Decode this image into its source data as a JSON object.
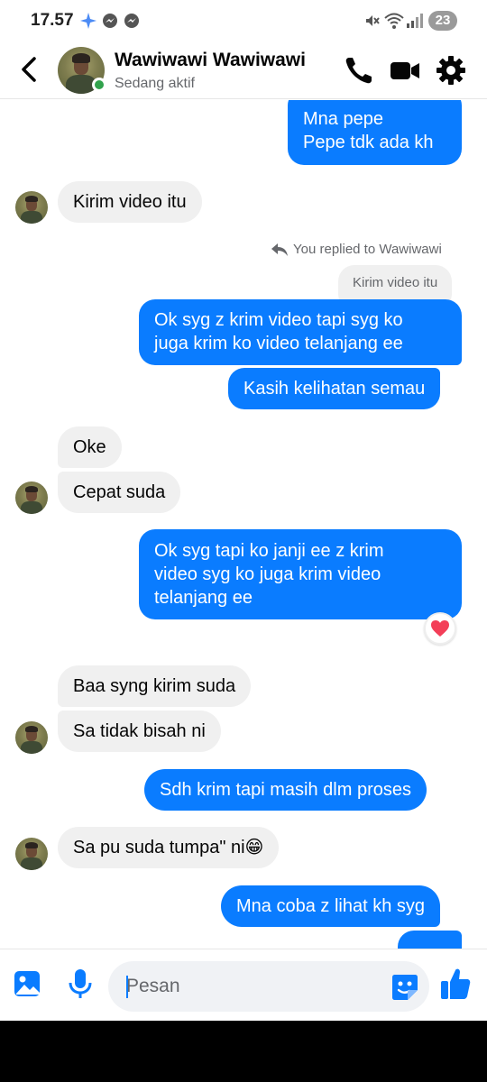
{
  "status_bar": {
    "time": "17.57",
    "notification_count": "23"
  },
  "header": {
    "name": "Wawiwawi Wawiwawi",
    "status": "Sedang aktif"
  },
  "messages": [
    {
      "text": "Mna pepe\nPepe tdk ada kh",
      "direction": "outgoing"
    },
    {
      "text": "Kirim video itu",
      "direction": "incoming"
    },
    {
      "text": "You replied to Wawiwawi",
      "type": "reply_note"
    },
    {
      "text": "Kirim video itu",
      "type": "quoted"
    },
    {
      "text": "Ok syg z krim video tapi syg ko\njuga krim ko video telanjang ee",
      "direction": "outgoing"
    },
    {
      "text": "Kasih kelihatan semau",
      "direction": "outgoing"
    },
    {
      "text": "Oke",
      "direction": "incoming"
    },
    {
      "text": "Cepat suda",
      "direction": "incoming"
    },
    {
      "text": "Ok syg tapi ko janji ee z krim\nvideo syg ko juga krim video\ntelanjang ee",
      "direction": "outgoing",
      "reaction": "heart"
    },
    {
      "text": "Baa syng kirim suda",
      "direction": "incoming"
    },
    {
      "text": "Sa tidak bisah ni",
      "direction": "incoming"
    },
    {
      "text": "Sdh krim tapi masih dlm proses",
      "direction": "outgoing"
    },
    {
      "text": "Sa pu suda tumpa\" ni😁",
      "direction": "incoming"
    },
    {
      "text": "Mna coba z lihat kh syg",
      "direction": "outgoing"
    }
  ],
  "composer": {
    "placeholder": "Pesan"
  },
  "colors": {
    "outgoing_bubble": "#0a7cff",
    "incoming_bubble": "#f0f0f0",
    "accent": "#0a7cff",
    "online": "#31a24c"
  },
  "icons": [
    "back-arrow-icon",
    "phone-icon",
    "video-camera-icon",
    "gear-icon",
    "gallery-icon",
    "microphone-icon",
    "sticker-icon",
    "thumbs-up-icon",
    "heart-reaction-icon",
    "reply-arrow-icon"
  ]
}
